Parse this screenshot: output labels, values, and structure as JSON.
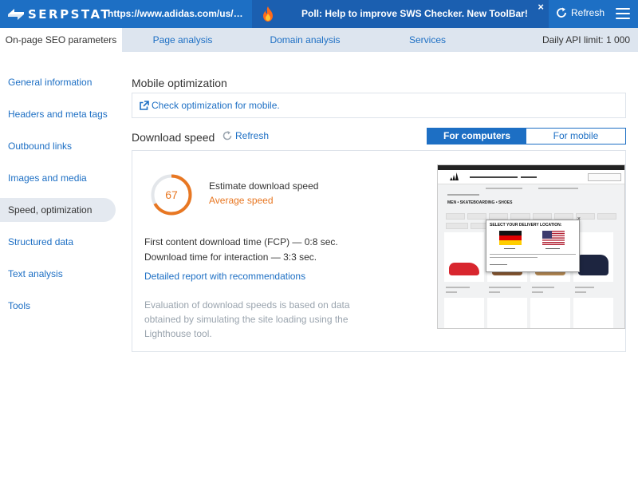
{
  "header": {
    "logo_text": "SERPSTAT",
    "url": "https://www.adidas.com/us/men-skateboarding-shoes",
    "poll_text": "Poll: Help to improve SWS Checker. New ToolBar!",
    "poll_close": "×",
    "refresh_label": "Refresh"
  },
  "tabs": [
    {
      "label": "On-page SEO parameters",
      "active": true
    },
    {
      "label": "Page analysis",
      "active": false
    },
    {
      "label": "Domain analysis",
      "active": false
    },
    {
      "label": "Services",
      "active": false
    }
  ],
  "api_limit": "Daily API limit: 1 000",
  "sidebar": {
    "items": [
      {
        "label": "General information"
      },
      {
        "label": "Headers and meta tags"
      },
      {
        "label": "Outbound links"
      },
      {
        "label": "Images and media"
      },
      {
        "label": "Speed, optimization",
        "active": true
      },
      {
        "label": "Structured data"
      },
      {
        "label": "Text analysis"
      },
      {
        "label": "Tools"
      }
    ]
  },
  "mobile": {
    "title": "Mobile optimization",
    "check_link": "Check optimization for mobile."
  },
  "download": {
    "title": "Download speed",
    "refresh_label": "Refresh",
    "toggle": {
      "computers": "For computers",
      "mobile": "For mobile",
      "selected": "computers"
    },
    "score": "67",
    "score_fraction": 0.67,
    "estimate_label": "Estimate download speed",
    "estimate_value": "Average speed",
    "fcp": "First content download time (FCP) — 0:8 sec.",
    "interaction": "Download time for interaction — 3:3 sec.",
    "report_link": "Detailed report with recommendations",
    "note": "Evaluation of download speeds is based on data obtained by simulating the site loading using the Lighthouse tool."
  },
  "preview": {
    "page_heading": "MEN • SKATEBOARDING • SHOES",
    "modal_title": "SELECT YOUR DELIVERY LOCATION:"
  },
  "colors": {
    "brand_blue": "#1d6fc4",
    "accent_orange": "#e87722",
    "muted_text": "#9aa4ae"
  }
}
